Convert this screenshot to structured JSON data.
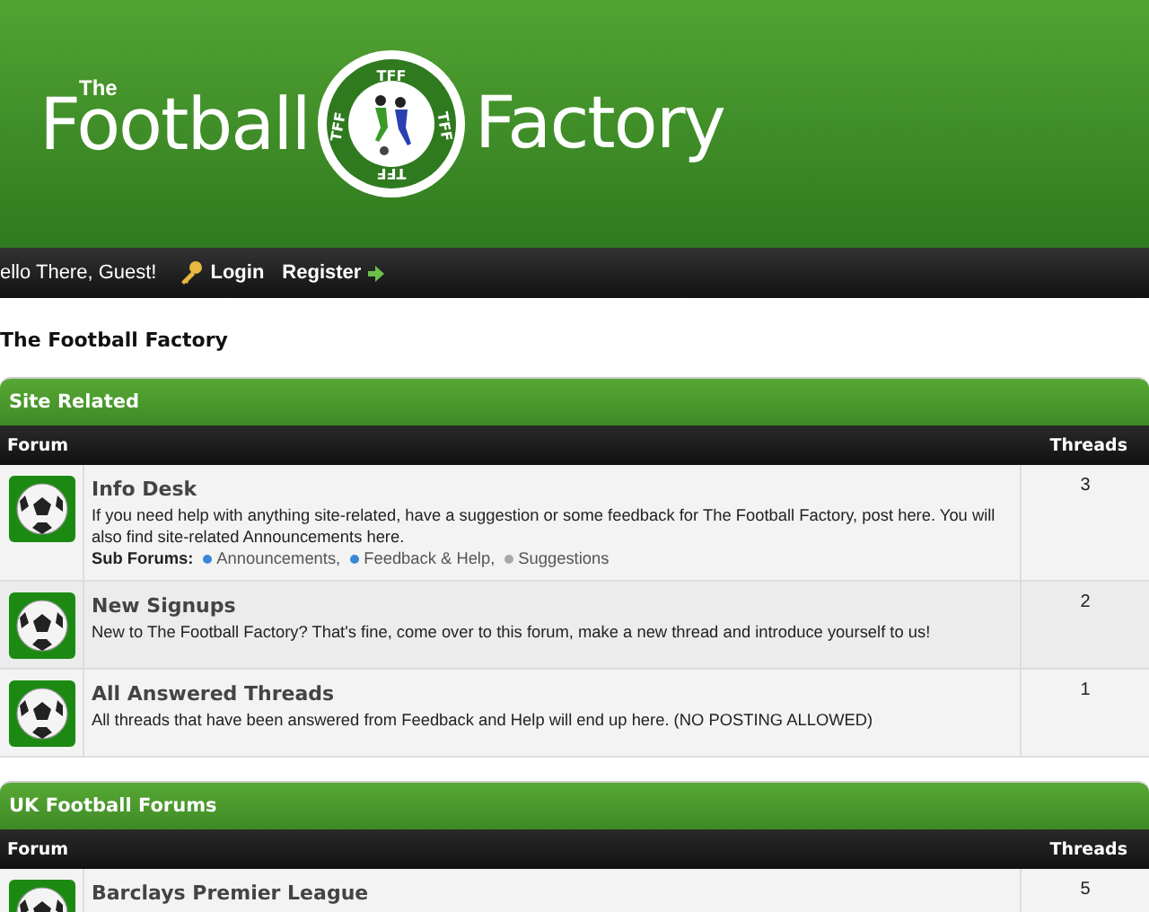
{
  "logo": {
    "small": "The",
    "left": "Football",
    "right": "Factory",
    "badge_labels": [
      "TFF",
      "TFF",
      "TFF",
      "TFF"
    ]
  },
  "nav": {
    "greeting": "ello There, Guest!",
    "links": [
      {
        "label": "Login",
        "kind": "key"
      },
      {
        "label": "Register",
        "kind": "arrow"
      }
    ]
  },
  "breadcrumb": "The Football Factory",
  "sections": [
    {
      "title": "Site Related",
      "columns": [
        "Forum",
        "Threads"
      ],
      "forums": [
        {
          "name": "Info Desk",
          "description": "If you need help with anything site-related, have a suggestion or some feedback for The Football Factory, post here. You will also find site-related Announcements here.",
          "subforums_label": "Sub Forums:",
          "subforums": [
            {
              "name": "Announcements,",
              "color": "#3a87d6"
            },
            {
              "name": "Feedback & Help,",
              "color": "#3a87d6"
            },
            {
              "name": "Suggestions",
              "color": "#a8a8a8"
            }
          ],
          "threads": "3"
        },
        {
          "name": "New Signups",
          "description": "New to The Football Factory? That's fine, come over to this forum, make a new thread and introduce yourself to us!",
          "threads": "2"
        },
        {
          "name": "All Answered Threads",
          "description": "All threads that have been answered from Feedback and Help will end up here. (NO POSTING ALLOWED)",
          "threads": "1"
        }
      ]
    },
    {
      "title": "UK Football Forums",
      "columns": [
        "Forum",
        "Threads"
      ],
      "forums": [
        {
          "name": "Barclays Premier League",
          "threads": "5"
        }
      ]
    }
  ]
}
